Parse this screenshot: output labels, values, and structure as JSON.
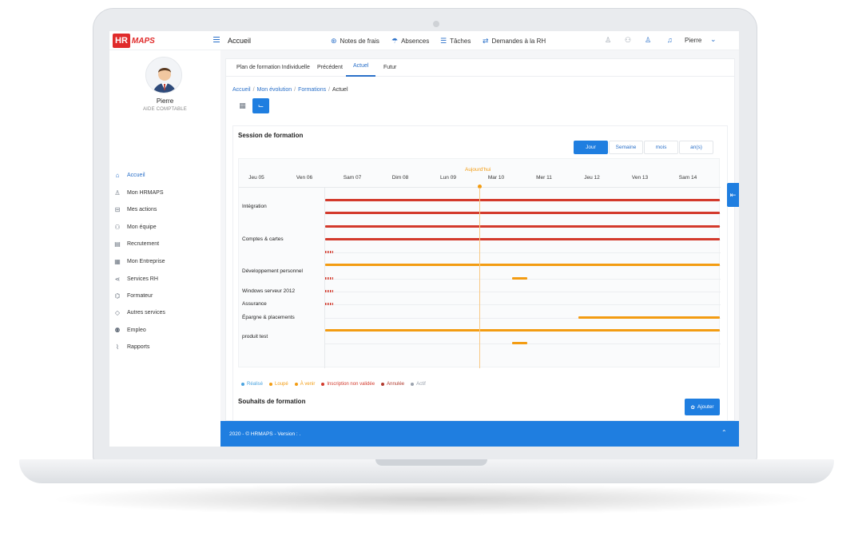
{
  "app": {
    "logo_hr": "HR",
    "logo_maps": "MAPS",
    "title": "Accueil"
  },
  "topnav": [
    {
      "icon": "money-icon",
      "glyph": "⊛",
      "label": "Notes de frais"
    },
    {
      "icon": "umbrella-icon",
      "glyph": "☂",
      "label": "Absences"
    },
    {
      "icon": "tasks-icon",
      "glyph": "☰",
      "label": "Tâches"
    },
    {
      "icon": "exchange-icon",
      "glyph": "⇄",
      "label": "Demandes à la RH"
    }
  ],
  "user": {
    "name": "Pierre"
  },
  "profile": {
    "name": "Pierre",
    "role": "AIDE COMPTABLE"
  },
  "sidebar": [
    {
      "label": "Accueil",
      "icon": "home-icon",
      "glyph": "⌂"
    },
    {
      "label": "Mon HRMAPS",
      "icon": "user-icon",
      "glyph": "♙"
    },
    {
      "label": "Mes actions",
      "icon": "actions-icon",
      "glyph": "⊟"
    },
    {
      "label": "Mon équipe",
      "icon": "team-icon",
      "glyph": "⚇"
    },
    {
      "label": "Recrutement",
      "icon": "recruit-icon",
      "glyph": "▤"
    },
    {
      "label": "Mon Entreprise",
      "icon": "building-icon",
      "glyph": "▦"
    },
    {
      "label": "Services RH",
      "icon": "share-icon",
      "glyph": "⋖"
    },
    {
      "label": "Formateur",
      "icon": "graduation-icon",
      "glyph": "⌬"
    },
    {
      "label": "Autres services",
      "icon": "tag-icon",
      "glyph": "◇"
    },
    {
      "label": "Empleo",
      "icon": "users-icon",
      "glyph": "⚉"
    },
    {
      "label": "Rapports",
      "icon": "chart-icon",
      "glyph": "⌇"
    }
  ],
  "tabs": [
    "Plan de formation Individuelle",
    "Précédent",
    "Actuel",
    "Futur"
  ],
  "breadcrumb": {
    "items": [
      "Accueil",
      "Mon évolution",
      "Formations"
    ],
    "current": "Actuel"
  },
  "session": {
    "title": "Session de formation",
    "ranges": [
      "Jour",
      "Semaine",
      "mois",
      "an(s)"
    ],
    "today_label": "Aujourd'hui",
    "days": [
      "Jeu 05",
      "Ven 06",
      "Sam 07",
      "Dim 08",
      "Lun 09",
      "Mar 10",
      "Mer 11",
      "Jeu 12",
      "Ven 13",
      "Sam 14"
    ],
    "rows": [
      "Intégration",
      "Comptes & cartes",
      "Développement personnel",
      "Windows serveur 2012",
      "Assurance",
      "Épargne & placements",
      "produit test"
    ]
  },
  "legend": [
    {
      "label": "Réalisé",
      "color": "#4aa3df"
    },
    {
      "label": "Loupé",
      "color": "#f39c12"
    },
    {
      "label": "À venir",
      "color": "#f39c12"
    },
    {
      "label": "Inscription non validée",
      "color": "#d33a2c"
    },
    {
      "label": "Annulée",
      "color": "#b03a2e"
    },
    {
      "label": "Actif",
      "color": "#9aa2ad"
    }
  ],
  "wishes": {
    "title": "Souhaits de formation",
    "add_label": "Ajouter"
  },
  "footer": {
    "text": "2020 - © HRMAPS - Version : ."
  },
  "colors": {
    "accent": "#1f7ee0",
    "brand": "#e02b2b",
    "bar_red": "#d33a2c",
    "bar_orange": "#f39c12"
  }
}
